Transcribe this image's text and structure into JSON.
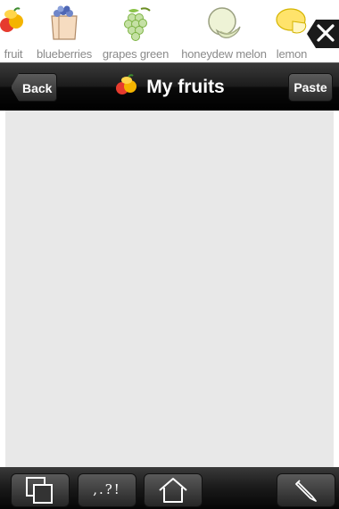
{
  "strip": {
    "items": [
      {
        "label": "fruit",
        "icon": "mixed-fruit-icon"
      },
      {
        "label": "blueberries",
        "icon": "blueberries-icon"
      },
      {
        "label": "grapes green",
        "icon": "grapes-icon"
      },
      {
        "label": "honeydew melon",
        "icon": "melon-icon"
      },
      {
        "label": "lemon",
        "icon": "lemon-icon"
      }
    ],
    "close_icon": "close-icon"
  },
  "navbar": {
    "back_label": "Back",
    "title": "My fruits",
    "title_icon": "mixed-fruit-icon",
    "paste_label": "Paste"
  },
  "toolbar": {
    "buttons": [
      {
        "icon": "copy-windows-icon"
      },
      {
        "label": ",.?!",
        "icon": "punctuation"
      },
      {
        "icon": "home-icon"
      },
      {
        "icon": "pencil-icon"
      }
    ]
  },
  "colors": {
    "bar": "#000000",
    "content_bg": "#e8e8e8",
    "label_gray": "#8a8a8a"
  }
}
